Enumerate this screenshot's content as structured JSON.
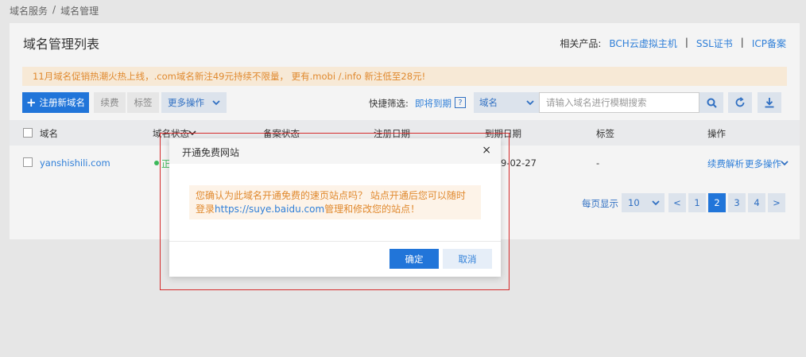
{
  "breadcrumb": [
    "域名服务",
    "/",
    "域名管理"
  ],
  "panel": {
    "title": "域名管理列表",
    "related_label": "相关产品:",
    "related_links": [
      "BCH云虚拟主机",
      "SSL证书",
      "ICP备案"
    ],
    "separator": "|"
  },
  "notice": "11月域名促销热潮火热上线，.com域名新注49元持续不限量， 更有.mobi /.info 新注低至28元!",
  "toolbar": {
    "register_label": "注册新域名",
    "renew_label": "续费",
    "tag_label": "标签",
    "more_label": "更多操作",
    "quick_filter_label": "快捷筛选:",
    "quick_filter_link": "即将到期",
    "help_mark": "?",
    "search_type": "域名",
    "search_placeholder": "请输入域名进行模糊搜索"
  },
  "table": {
    "columns": [
      "域名",
      "域名状态",
      "备案状态",
      "注册日期",
      "到期日期",
      "标签",
      "操作"
    ],
    "rows": [
      {
        "domain": "yanshishili.com",
        "status": "正",
        "expire_fragment": "9-02-27",
        "tag": "-",
        "actions": [
          "续费",
          "解析",
          "更多操作"
        ]
      }
    ]
  },
  "pagination": {
    "page_size_label": "每页显示",
    "page_size": "10",
    "prev": "<",
    "next": ">",
    "pages": [
      "1",
      "2",
      "3",
      "4"
    ],
    "current": "2"
  },
  "modal": {
    "title": "开通免费网站",
    "close": "×",
    "message_part1": "您确认为此域名开通免费的速页站点吗？ 站点开通后您可以随时登录",
    "message_link": "https://suye.baidu.com",
    "message_part2": "管理和修改您的站点！",
    "ok_label": "确定",
    "cancel_label": "取消"
  },
  "colors": {
    "primary": "#2175d9",
    "link": "#2f7fd8",
    "warning_text": "#e0892e",
    "success": "#3cb85a",
    "highlight_border": "#d42a2a"
  }
}
